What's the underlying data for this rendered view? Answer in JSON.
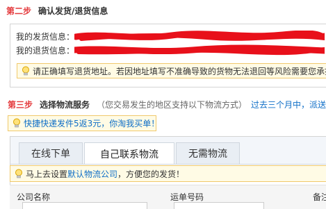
{
  "step2": {
    "no": "第二步",
    "title": "确认发货/退货信息",
    "ship_label": "我的发货信息：",
    "return_label": "我的退货信息：",
    "tip": "请正确填写退货地址。若因地址填写不准确导致的货物无法退回等风险需要您承担"
  },
  "step3": {
    "no": "第三步",
    "title": "选择物流服务",
    "desc": "（您交易发生的地区支持以下物流方式）",
    "link": "过去三个月中，派送",
    "tip_prefix": "快捷快递发件5返3元，你淘我买单！",
    "tabs": [
      "在线下单",
      "自己联系物流",
      "无需物流"
    ],
    "active_tab": 1,
    "default_tip_before": "马上去设置",
    "default_tip_link": "默认物流公司",
    "default_tip_after": "，方便您的发货！",
    "columns": [
      "公司名称",
      "运单号码",
      "备注"
    ]
  },
  "colors": {
    "accent_red": "#e4393c",
    "link_blue": "#0e6ec7",
    "tip_bg": "#fffbe5",
    "tip_border": "#f0c96b",
    "redaction": "#e8101a"
  }
}
